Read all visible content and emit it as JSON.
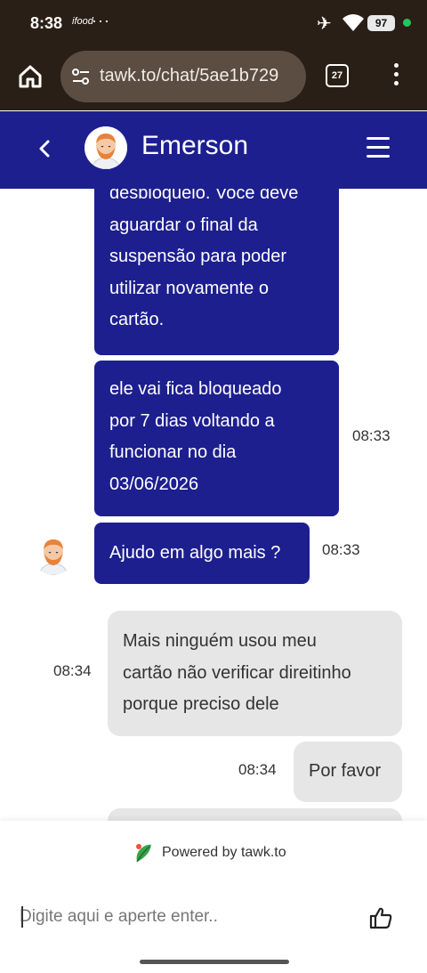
{
  "status": {
    "time": "8:38",
    "app_mark": "ifood",
    "dots": "···",
    "battery": "97"
  },
  "browser": {
    "url": "tawk.to/chat/5ae1b729",
    "tab_count": "27"
  },
  "chat": {
    "agent_name": "Emerson"
  },
  "messages": [
    {
      "from": "agent",
      "lines": [
        "desbloqueio. Você deve",
        "aguardar o final da",
        "suspensão para poder",
        "utilizar novamente o",
        "cartão."
      ],
      "time": ""
    },
    {
      "from": "agent",
      "lines": [
        "ele vai fica bloqueado",
        "por 7 dias voltando a",
        "funcionar no dia",
        "03/06/2026"
      ],
      "time": "08:33"
    },
    {
      "from": "agent",
      "lines": [
        "Ajudo em algo mais ?"
      ],
      "time": "08:33"
    },
    {
      "from": "visitor",
      "lines": [
        "Mais ninguém usou meu",
        "cartão não verificar direitinho",
        "porque preciso dele"
      ],
      "time": "08:34"
    },
    {
      "from": "visitor",
      "lines": [
        "Por favor"
      ],
      "time": "08:34"
    }
  ],
  "footer": {
    "powered_by": "Powered by tawk.to",
    "input_placeholder": "Digite aqui e aperte enter.."
  },
  "colors": {
    "agent_bubble": "#1d1f8f",
    "visitor_bubble": "#e6e6e6",
    "header_bg": "#1d1f8f"
  },
  "icons": [
    "home-icon",
    "site-settings-icon",
    "tabs-icon",
    "more-menu-icon",
    "back-arrow-icon",
    "hamburger-menu-icon",
    "tawk-leaf-icon",
    "thumbs-up-icon",
    "airplane-icon",
    "wifi-icon"
  ]
}
